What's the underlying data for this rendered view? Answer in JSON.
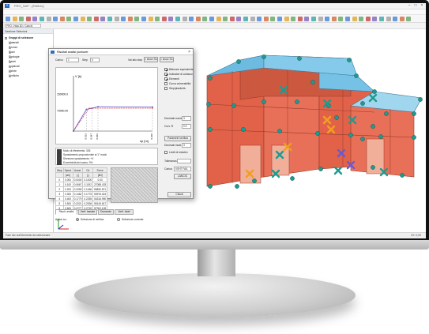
{
  "app": {
    "title": "PRO_SAP - [Edificio]",
    "menu": [
      "File",
      "Modifica",
      "Visualizza",
      "Selezioni",
      "Preverifica",
      "Dati Generali",
      "Modellazione",
      "Griglia",
      "Strumenti",
      "Disegno",
      "Finestra",
      "CIS",
      "?"
    ],
    "view_combo": "PRO: Vista 3D / Carichi",
    "status_left": "Fare clic sull'elemento da selezionare",
    "status_right": "ZX: 0,00"
  },
  "sidebar": {
    "header": "Gestione Selezioni",
    "items": [
      {
        "label": "Gruppi di selezione",
        "bold": true,
        "level": 0
      },
      {
        "label": "Materiali",
        "level": 1
      },
      {
        "label": "Sezioni",
        "level": 1
      },
      {
        "label": "Piani",
        "level": 1
      },
      {
        "label": "Tipologie",
        "level": 1
      },
      {
        "label": "Pareti",
        "level": 1
      },
      {
        "label": "Impalcati",
        "level": 1
      },
      {
        "label": "Utente",
        "level": 1
      },
      {
        "label": "Verifiche",
        "level": 1
      }
    ]
  },
  "dialog": {
    "title": "Risultati analisi pushover",
    "load_label": "Carico",
    "load_value": "1",
    "step_label": "Step",
    "step_value": "0",
    "passo_label": "Vai allo step",
    "show_sld": "< show SLD",
    "show_slc": "< show SLC",
    "graph_ylabel": "V [k]",
    "graph_xlabel": "sp [m]",
    "graph_y_top": "150000.0",
    "graph_y_mid": "70000.00",
    "graph_x_ticks": [
      "0.033",
      "0.047",
      "0.062",
      "0.200"
    ],
    "checks": [
      {
        "label": "Bilineare equivalente",
        "on": true
      },
      {
        "label": "Indicatori di collasso",
        "on": true
      },
      {
        "label": "Elementi",
        "on": true
      },
      {
        "label": "Curva vulnerabilità",
        "on": false
      },
      {
        "label": "Step/plasticità",
        "on": false
      }
    ],
    "dec_label": "Decimali curve",
    "dec_value": "3",
    "curva_label": "Curv. R",
    "curva_value": "0.3",
    "dec_res_label": "Decimali risult.",
    "dec_res_value": "3",
    "limits_label": "Limiti di resisten",
    "tol_label": "Tolleranza",
    "carica_label": "Carica",
    "carica_value": "VSHT FAIL",
    "lancio_button": "LANCIO",
    "calc_button": "Parametri verifica",
    "info_lines": [
      "Modo di riferimento: 326",
      "Spostamento proporzionale al 1° modo",
      "Direzione spostamento: +X",
      "Eccentricità del carico: 0%"
    ],
    "table_headers": [
      "Step",
      "Spost.",
      "Azzat.",
      "Cd",
      "Force"
    ],
    "table_units": [
      "",
      "[cm]",
      "[-]",
      "[-]",
      "[kN]"
    ],
    "table_rows": [
      [
        "0",
        "0.000",
        "0.0000",
        "0.1000",
        "0.00"
      ],
      [
        "1",
        "0.100",
        "0.0667",
        "0.1192",
        "27088.478"
      ],
      [
        "2",
        "0.200",
        "0.2059",
        "0.1456",
        "55830.871"
      ],
      [
        "3",
        "0.300",
        "0.1462",
        "0.1775",
        "53976.324"
      ],
      [
        "4",
        "0.400",
        "0.1779",
        "0.2255",
        "54316.990"
      ],
      [
        "5",
        "0.500",
        "0.2021",
        "0.2536",
        "55149.817"
      ],
      [
        "6",
        "0.600",
        "0.2277",
        "0.2720",
        "57302.109"
      ]
    ],
    "tabs": [
      "Risult. analisi",
      "Verif. tassate",
      "Domande",
      "Verif. totali"
    ],
    "filter_label": "Agisci su:",
    "radio1": "Selezione di verifica",
    "radio2": "Selezione corrente",
    "close_button": "Chiudi"
  },
  "chart_data": {
    "type": "line",
    "title": "",
    "xlabel": "sp [m]",
    "ylabel": "V [k]",
    "series": [
      {
        "name": "",
        "x": [
          0,
          0.033,
          0.047,
          0.062,
          0.2
        ],
        "y": [
          0,
          59000,
          62000,
          66000,
          65000
        ]
      },
      {
        "name": "",
        "x": [
          0,
          0.04,
          0.2
        ],
        "y": [
          0,
          62000,
          62000
        ]
      }
    ],
    "ylim": [
      0,
      150000
    ]
  }
}
